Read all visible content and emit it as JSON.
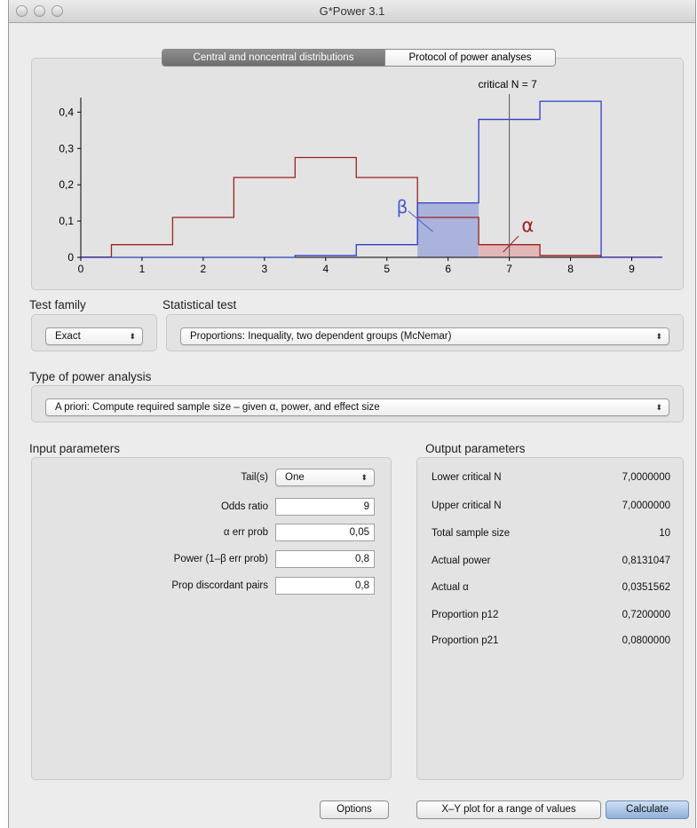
{
  "window": {
    "title": "G*Power 3.1"
  },
  "tabs": [
    {
      "label": "Central and noncentral distributions",
      "active": true
    },
    {
      "label": "Protocol of power analyses",
      "active": false
    }
  ],
  "chart_data": {
    "type": "line",
    "critical_label": "critical N = 7",
    "critical_x": 7,
    "x_ticks": [
      "0",
      "1",
      "2",
      "3",
      "4",
      "5",
      "6",
      "7",
      "8",
      "9"
    ],
    "y_ticks": [
      "0",
      "0,1",
      "0,2",
      "0,3",
      "0,4"
    ],
    "xlim": [
      0,
      9.5
    ],
    "ylim": [
      0,
      0.44
    ],
    "beta_symbol": "β",
    "alpha_symbol": "α",
    "series": [
      {
        "color": "#9b2323",
        "x": [
          0,
          1,
          2,
          3,
          4,
          5,
          6,
          7,
          8,
          9
        ],
        "values": [
          0.001,
          0.035,
          0.11,
          0.22,
          0.275,
          0.22,
          0.11,
          0.035,
          0.005,
          0.0005
        ]
      },
      {
        "color": "#2d3fc4",
        "x": [
          0,
          1,
          2,
          3,
          4,
          5,
          6,
          7,
          8,
          9
        ],
        "values": [
          0,
          0,
          0,
          0,
          0.005,
          0.035,
          0.15,
          0.38,
          0.43,
          0
        ]
      }
    ],
    "colors": {
      "alpha_fill": "#e3b7b7",
      "beta_fill": "#aab3dc",
      "alpha_text": "#a01e1e",
      "beta_text": "#4a5ad0"
    }
  },
  "test_family": {
    "label": "Test family",
    "value": "Exact"
  },
  "statistical_test": {
    "label": "Statistical test",
    "value": "Proportions: Inequality, two dependent groups (McNemar)"
  },
  "power_analysis": {
    "label": "Type of power analysis",
    "value": "A priori: Compute required sample size – given α, power, and effect size"
  },
  "input": {
    "label": "Input parameters",
    "tails": {
      "label": "Tail(s)",
      "value": "One"
    },
    "rows": [
      {
        "label": "Odds ratio",
        "value": "9"
      },
      {
        "label": "α err prob",
        "value": "0,05"
      },
      {
        "label": "Power (1–β err prob)",
        "value": "0,8"
      },
      {
        "label": "Prop discordant pairs",
        "value": "0,8"
      }
    ]
  },
  "output": {
    "label": "Output parameters",
    "rows": [
      {
        "label": "Lower critical N",
        "value": "7,0000000"
      },
      {
        "label": "Upper critical N",
        "value": "7,0000000"
      },
      {
        "label": "Total sample size",
        "value": "10"
      },
      {
        "label": "Actual power",
        "value": "0,8131047"
      },
      {
        "label": "Actual α",
        "value": "0,0351562"
      },
      {
        "label": "Proportion p12",
        "value": "0,7200000"
      },
      {
        "label": "Proportion p21",
        "value": "0,0800000"
      }
    ]
  },
  "buttons": {
    "options": "Options",
    "xy_plot": "X–Y plot for a range of values",
    "calculate": "Calculate"
  }
}
